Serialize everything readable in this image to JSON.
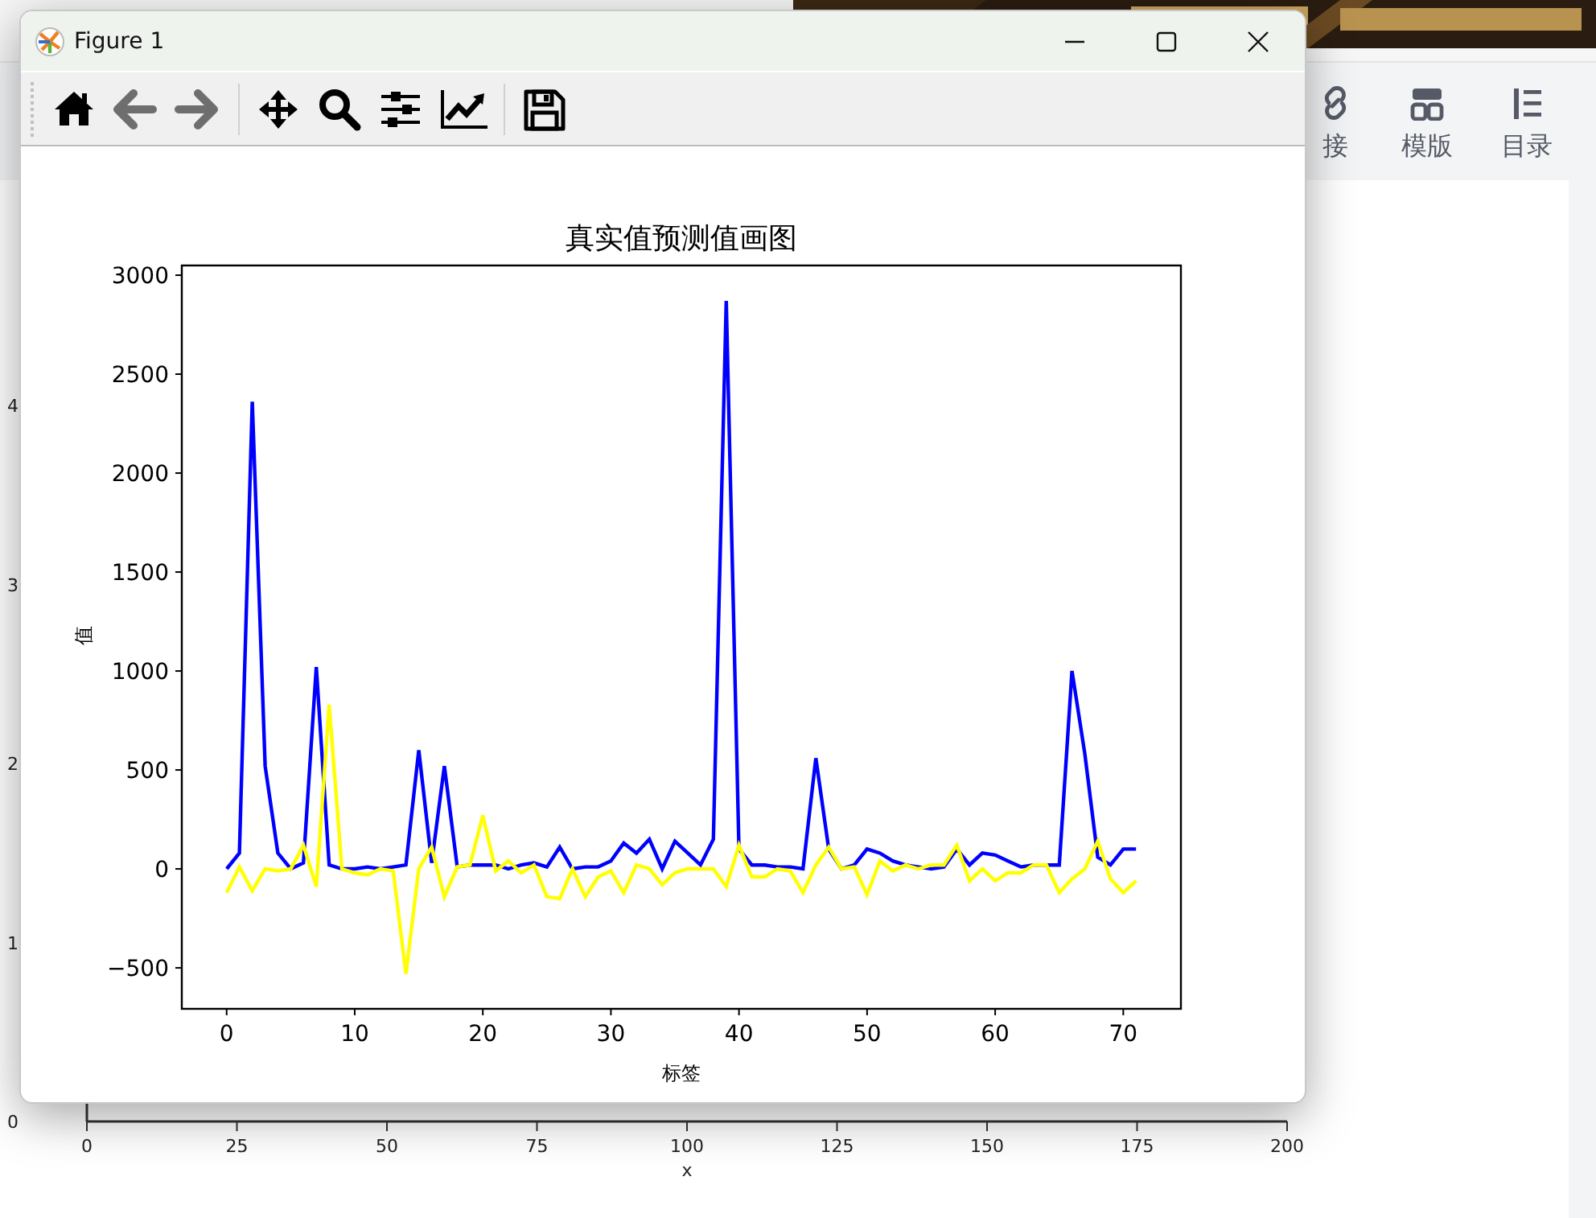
{
  "background_page": {
    "toolbar": [
      {
        "kind": "link",
        "label": "接"
      },
      {
        "kind": "template",
        "label": "模版"
      },
      {
        "kind": "outline",
        "label": "目录"
      }
    ],
    "chart": {
      "y_tick_labels": [
        "4",
        "3",
        "2",
        "1",
        "0"
      ],
      "x_tick_labels": [
        "0",
        "25",
        "50",
        "75",
        "100",
        "125",
        "150",
        "175",
        "200"
      ],
      "xlabel": "x"
    }
  },
  "window": {
    "title": "Figure 1",
    "toolbar": [
      {
        "kind": "home",
        "disabled": false
      },
      {
        "kind": "back",
        "disabled": true
      },
      {
        "kind": "forward",
        "disabled": true
      },
      {
        "kind": "pan",
        "disabled": false
      },
      {
        "kind": "zoom",
        "disabled": false
      },
      {
        "kind": "subplots",
        "disabled": false
      },
      {
        "kind": "edit-curves",
        "disabled": false
      },
      {
        "kind": "save",
        "disabled": false
      }
    ]
  },
  "figure": {
    "chart_data": {
      "type": "line",
      "title": "真实值预测值画图",
      "xlabel": "标签",
      "ylabel": "值",
      "x": [
        0,
        1,
        2,
        3,
        4,
        5,
        6,
        7,
        8,
        9,
        10,
        11,
        12,
        13,
        14,
        15,
        16,
        17,
        18,
        19,
        20,
        21,
        22,
        23,
        24,
        25,
        26,
        27,
        28,
        29,
        30,
        31,
        32,
        33,
        34,
        35,
        36,
        37,
        38,
        39,
        40,
        41,
        42,
        43,
        44,
        45,
        46,
        47,
        48,
        49,
        50,
        51,
        52,
        53,
        54,
        55,
        56,
        57,
        58,
        59,
        60,
        61,
        62,
        63,
        64,
        65,
        66,
        67,
        68,
        69,
        70,
        71
      ],
      "series": [
        {
          "color": "#0000ff",
          "values": [
            0,
            80,
            2360,
            520,
            80,
            0,
            30,
            1020,
            20,
            0,
            0,
            10,
            0,
            10,
            20,
            600,
            30,
            520,
            10,
            20,
            20,
            20,
            0,
            20,
            30,
            10,
            110,
            0,
            10,
            10,
            40,
            130,
            80,
            150,
            0,
            140,
            80,
            20,
            150,
            2870,
            100,
            20,
            20,
            10,
            10,
            0,
            560,
            100,
            0,
            20,
            100,
            80,
            40,
            20,
            10,
            0,
            10,
            100,
            20,
            80,
            70,
            40,
            10,
            20,
            20,
            20,
            1000,
            580,
            60,
            20,
            100,
            100
          ]
        },
        {
          "color": "#ffff00",
          "values": [
            -120,
            10,
            -110,
            0,
            -10,
            0,
            120,
            -90,
            830,
            0,
            -20,
            -30,
            0,
            -10,
            -530,
            0,
            110,
            -140,
            10,
            20,
            270,
            -10,
            40,
            -20,
            20,
            -140,
            -150,
            0,
            -140,
            -40,
            -10,
            -120,
            20,
            0,
            -80,
            -20,
            0,
            0,
            0,
            -90,
            120,
            -40,
            -40,
            0,
            -10,
            -120,
            20,
            110,
            0,
            10,
            -130,
            40,
            -10,
            20,
            0,
            20,
            20,
            120,
            -60,
            0,
            -60,
            -20,
            -20,
            20,
            20,
            -120,
            -50,
            0,
            140,
            -50,
            -120,
            -60
          ]
        }
      ],
      "xlim": [
        -3.5,
        74.5
      ],
      "ylim": [
        -707,
        3049
      ],
      "xticks": [
        0,
        10,
        20,
        30,
        40,
        50,
        60,
        70
      ],
      "yticks": [
        -500,
        0,
        500,
        1000,
        1500,
        2000,
        2500,
        3000
      ]
    }
  }
}
